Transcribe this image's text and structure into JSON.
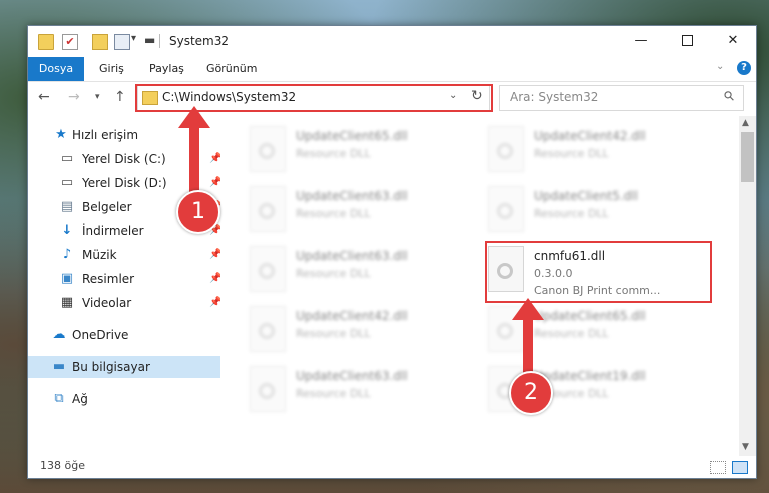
{
  "window": {
    "title": "System32",
    "min_glyph": "—",
    "close_glyph": "✕"
  },
  "quick_access": {
    "check_glyph": "✔",
    "dropdown_glyph": "▾",
    "dash_glyph": "▬"
  },
  "ribbon": {
    "tabs": [
      "Dosya",
      "Giriş",
      "Paylaş",
      "Görünüm"
    ],
    "chevron_glyph": "⌄",
    "help_glyph": "?"
  },
  "nav": {
    "back_glyph": "←",
    "forward_glyph": "→",
    "recent_glyph": "▾",
    "up_glyph": "↑",
    "address": "C:\\Windows\\System32",
    "address_dropdown_glyph": "⌄",
    "refresh_glyph": "↻",
    "search_placeholder": "Ara: System32",
    "search_glyph": "⚲"
  },
  "sidebar": {
    "pin_glyph": "📌",
    "items": [
      {
        "label": "Hızlı erişim",
        "icon": "★"
      },
      {
        "label": "Yerel Disk (C:)",
        "icon": "▭"
      },
      {
        "label": "Yerel Disk (D:)",
        "icon": "▭"
      },
      {
        "label": "Belgeler",
        "icon": "▤"
      },
      {
        "label": "İndirmeler",
        "icon": "↓"
      },
      {
        "label": "Müzik",
        "icon": "♪"
      },
      {
        "label": "Resimler",
        "icon": "▣"
      },
      {
        "label": "Videolar",
        "icon": "▦"
      },
      {
        "label": "OneDrive",
        "icon": "☁"
      },
      {
        "label": "Bu bilgisayar",
        "icon": "▬"
      },
      {
        "label": "Ağ",
        "icon": "⧉"
      }
    ]
  },
  "files": [
    {
      "name": "UpdateClient65.dll",
      "desc": "Resource DLL"
    },
    {
      "name": "UpdateClient42.dll",
      "desc": "Resource DLL"
    },
    {
      "name": "UpdateClient63.dll",
      "desc": "Resource DLL"
    },
    {
      "name": "UpdateClient5.dll",
      "desc": "Resource DLL"
    },
    {
      "name": "UpdateClient63.dll",
      "desc": "Resource DLL"
    },
    {
      "name": "cnmfu61.dll",
      "desc": "0.3.0.0",
      "extra": "Canon BJ Print comm..."
    },
    {
      "name": "UpdateClient42.dll",
      "desc": "Resource DLL"
    },
    {
      "name": "UpdateClient65.dll",
      "desc": "Resource DLL"
    },
    {
      "name": "UpdateClient63.dll",
      "desc": "Resource DLL"
    },
    {
      "name": "UpdateClient19.dll",
      "desc": "Resource DLL"
    }
  ],
  "scrollbar": {
    "up_glyph": "▲",
    "down_glyph": "▼"
  },
  "status": {
    "item_count": "138 öğe"
  },
  "callouts": [
    {
      "number": "1"
    },
    {
      "number": "2"
    }
  ],
  "colors": {
    "accent": "#1979ca",
    "callout_red": "#e23c3c",
    "selected": "#cce4f7"
  }
}
